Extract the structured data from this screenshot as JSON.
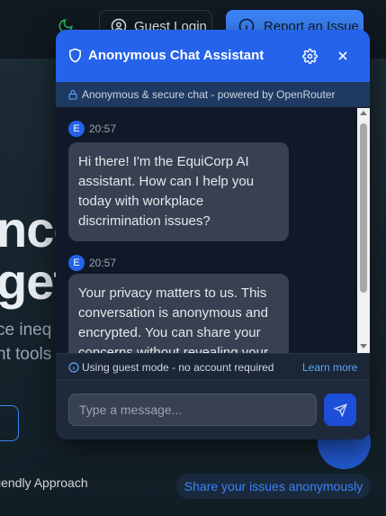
{
  "background": {
    "topbar": {
      "guest_login_label": "Guest Login",
      "report_issue_label": "Report an Issue"
    },
    "hero": {
      "line1": "nce",
      "line2": "get",
      "sub1": "ce ineq",
      "sub2": "nt tools"
    },
    "friendly_text": "iendly Approach",
    "share_label": "Share your issues anonymously"
  },
  "chat": {
    "title": "Anonymous Chat Assistant",
    "secure_text": "Anonymous & secure chat - powered by OpenRouter",
    "messages": [
      {
        "avatar": "E",
        "time": "20:57",
        "text": "Hi there! I'm the EquiCorp AI assistant. How can I help you today with workplace discrimination issues?"
      },
      {
        "avatar": "E",
        "time": "20:57",
        "text": "Your privacy matters to us. This conversation is anonymous and encrypted. You can share your concerns without revealing your"
      }
    ],
    "guest_text": "Using guest mode - no account required",
    "learn_more": "Learn more",
    "input_placeholder": "Type a message..."
  },
  "colors": {
    "accent": "#2563eb",
    "link": "#60a5fa",
    "bubble": "#374151",
    "panel": "#111827"
  },
  "icons": [
    "moon-icon",
    "user-circle-icon",
    "info-icon",
    "shield-icon",
    "gear-icon",
    "close-icon",
    "lock-icon",
    "send-icon",
    "chat-icon"
  ]
}
